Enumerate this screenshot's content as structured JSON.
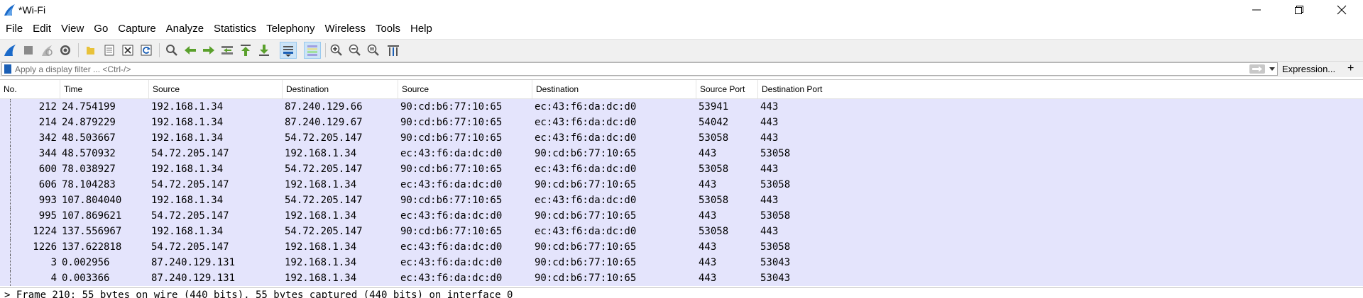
{
  "window": {
    "title": "*Wi-Fi"
  },
  "menu": [
    "File",
    "Edit",
    "View",
    "Go",
    "Capture",
    "Analyze",
    "Statistics",
    "Telephony",
    "Wireless",
    "Tools",
    "Help"
  ],
  "filter": {
    "placeholder": "Apply a display filter ... <Ctrl-/>",
    "expression_label": "Expression...",
    "plus_label": "+"
  },
  "columns": [
    "No.",
    "Time",
    "Source",
    "Destination",
    "Source",
    "Destination",
    "Source Port",
    "Destination Port"
  ],
  "rows": [
    {
      "no": "212",
      "time": "24.754199",
      "src": "192.168.1.34",
      "dst": "87.240.129.66",
      "hwsrc": "90:cd:b6:77:10:65",
      "hwdst": "ec:43:f6:da:dc:d0",
      "sport": "53941",
      "dport": "443"
    },
    {
      "no": "214",
      "time": "24.879229",
      "src": "192.168.1.34",
      "dst": "87.240.129.67",
      "hwsrc": "90:cd:b6:77:10:65",
      "hwdst": "ec:43:f6:da:dc:d0",
      "sport": "54042",
      "dport": "443"
    },
    {
      "no": "342",
      "time": "48.503667",
      "src": "192.168.1.34",
      "dst": "54.72.205.147",
      "hwsrc": "90:cd:b6:77:10:65",
      "hwdst": "ec:43:f6:da:dc:d0",
      "sport": "53058",
      "dport": "443"
    },
    {
      "no": "344",
      "time": "48.570932",
      "src": "54.72.205.147",
      "dst": "192.168.1.34",
      "hwsrc": "ec:43:f6:da:dc:d0",
      "hwdst": "90:cd:b6:77:10:65",
      "sport": "443",
      "dport": "53058"
    },
    {
      "no": "600",
      "time": "78.038927",
      "src": "192.168.1.34",
      "dst": "54.72.205.147",
      "hwsrc": "90:cd:b6:77:10:65",
      "hwdst": "ec:43:f6:da:dc:d0",
      "sport": "53058",
      "dport": "443"
    },
    {
      "no": "606",
      "time": "78.104283",
      "src": "54.72.205.147",
      "dst": "192.168.1.34",
      "hwsrc": "ec:43:f6:da:dc:d0",
      "hwdst": "90:cd:b6:77:10:65",
      "sport": "443",
      "dport": "53058"
    },
    {
      "no": "993",
      "time": "107.804040",
      "src": "192.168.1.34",
      "dst": "54.72.205.147",
      "hwsrc": "90:cd:b6:77:10:65",
      "hwdst": "ec:43:f6:da:dc:d0",
      "sport": "53058",
      "dport": "443"
    },
    {
      "no": "995",
      "time": "107.869621",
      "src": "54.72.205.147",
      "dst": "192.168.1.34",
      "hwsrc": "ec:43:f6:da:dc:d0",
      "hwdst": "90:cd:b6:77:10:65",
      "sport": "443",
      "dport": "53058"
    },
    {
      "no": "1224",
      "time": "137.556967",
      "src": "192.168.1.34",
      "dst": "54.72.205.147",
      "hwsrc": "90:cd:b6:77:10:65",
      "hwdst": "ec:43:f6:da:dc:d0",
      "sport": "53058",
      "dport": "443"
    },
    {
      "no": "1226",
      "time": "137.622818",
      "src": "54.72.205.147",
      "dst": "192.168.1.34",
      "hwsrc": "ec:43:f6:da:dc:d0",
      "hwdst": "90:cd:b6:77:10:65",
      "sport": "443",
      "dport": "53058"
    },
    {
      "no": "3",
      "time": "0.002956",
      "src": "87.240.129.131",
      "dst": "192.168.1.34",
      "hwsrc": "ec:43:f6:da:dc:d0",
      "hwdst": "90:cd:b6:77:10:65",
      "sport": "443",
      "dport": "53043"
    },
    {
      "no": "4",
      "time": "0.003366",
      "src": "87.240.129.131",
      "dst": "192.168.1.34",
      "hwsrc": "ec:43:f6:da:dc:d0",
      "hwdst": "90:cd:b6:77:10:65",
      "sport": "443",
      "dport": "53043"
    }
  ],
  "details": {
    "first_line": "> Frame 210: 55 bytes on wire (440 bits), 55 bytes captured (440 bits) on interface 0"
  },
  "colors": {
    "row_background": "#e4e4fc",
    "toolbar_background": "#f0f0f0",
    "accent": "#1b5fb5"
  }
}
